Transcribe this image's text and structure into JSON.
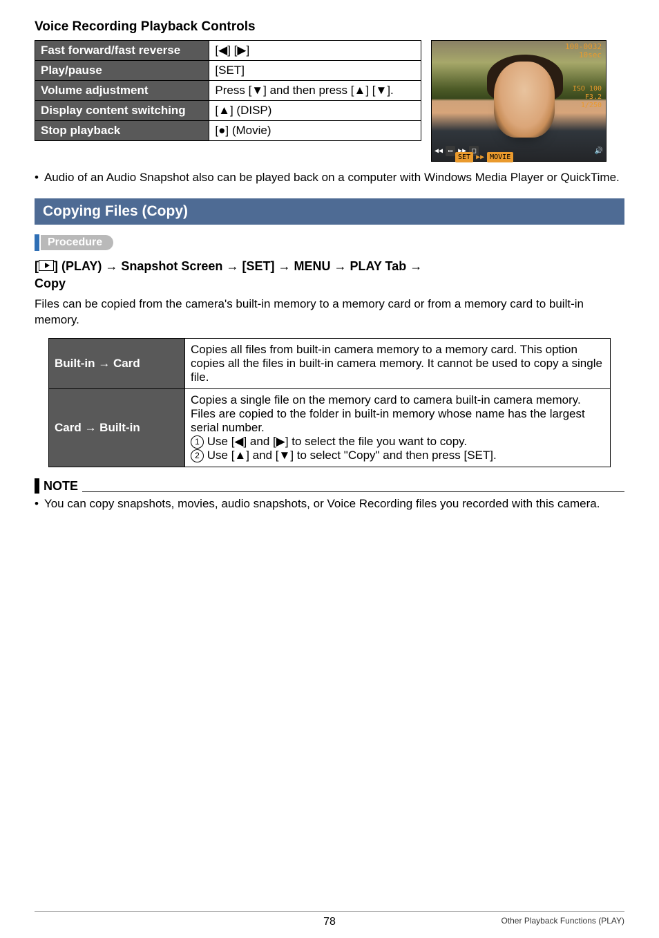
{
  "heading_controls": "Voice Recording Playback Controls",
  "controls_table": [
    {
      "label": "Fast forward/fast reverse",
      "value": "[◀] [▶]"
    },
    {
      "label": "Play/pause",
      "value": "[SET]"
    },
    {
      "label": "Volume adjustment",
      "value": "Press [▼] and then press [▲] [▼]."
    },
    {
      "label": "Display content switching",
      "value": "[▲] (DISP)"
    },
    {
      "label": "Stop playback",
      "value": "[●] (Movie)"
    }
  ],
  "photo_overlay": {
    "id": "100-0032",
    "time": "10sec",
    "iso": "ISO 100",
    "f": "F3.2",
    "shutter": "1/250",
    "set_label": "SET",
    "movie_label": "MOVIE"
  },
  "audio_note": "Audio of an Audio Snapshot also can be played back on a computer with Windows Media Player or QuickTime.",
  "section_title": "Copying Files (Copy)",
  "procedure_label": "Procedure",
  "play_path": {
    "prefix": "[",
    "play_label": "] (PLAY)",
    "arrow": " → ",
    "p1": "Snapshot Screen",
    "p2": "[SET]",
    "p3": "MENU",
    "p4": "PLAY Tab",
    "p5": "Copy"
  },
  "copy_intro": "Files can be copied from the camera's built-in memory to a memory card or from a memory card to built-in memory.",
  "copy_rows": {
    "r1_label": "Built-in → Card",
    "r1_text": "Copies all files from built-in camera memory to a memory card. This option copies all the files in built-in camera memory. It cannot be used to copy a single file.",
    "r2_label": "Card → Built-in",
    "r2_line1": "Copies a single file on the memory card to camera built-in camera memory. Files are copied to the folder in built-in memory whose name has the largest serial number.",
    "r2_step1": "Use [◀] and [▶] to select the file you want to copy.",
    "r2_step2": "Use [▲] and [▼] to select \"Copy\" and then press [SET]."
  },
  "note_heading": "NOTE",
  "note_bullet": "You can copy snapshots, movies, audio snapshots, or Voice Recording files you recorded with this camera.",
  "footer": {
    "page": "78",
    "section": "Other Playback Functions (PLAY)"
  },
  "chart_data": null
}
